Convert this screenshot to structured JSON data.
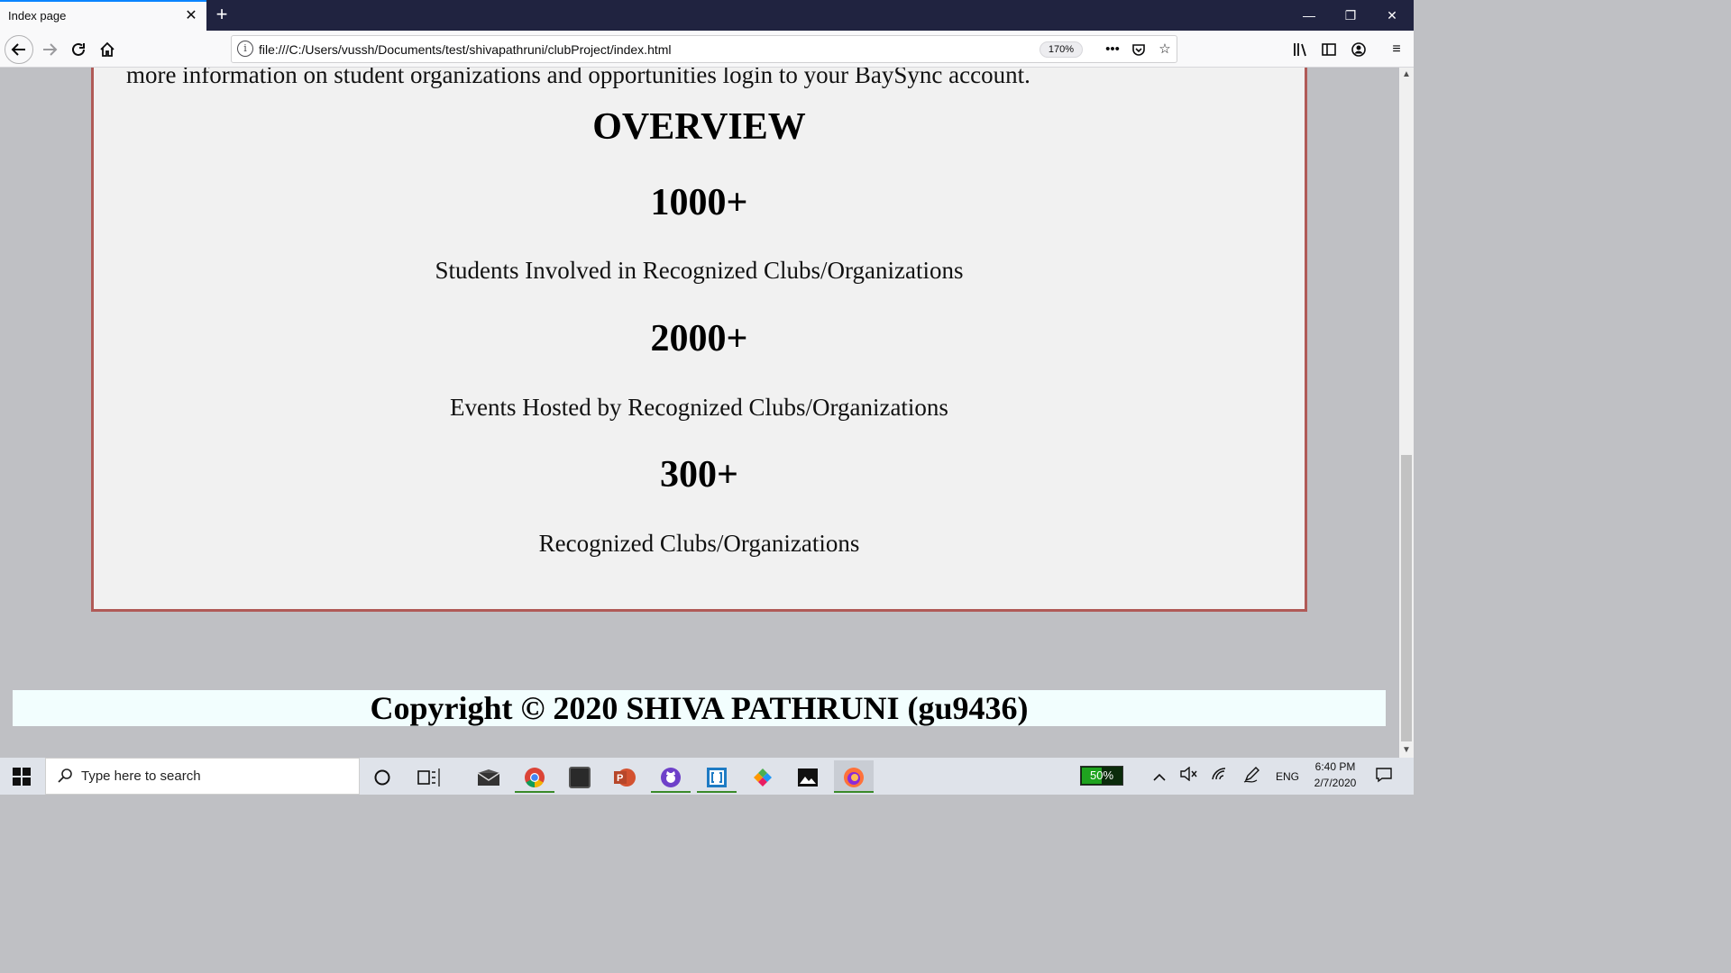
{
  "browser": {
    "tab_title": "Index page",
    "tab_close": "✕",
    "new_tab": "+",
    "url": "file:///C:/Users/vussh/Documents/test/shivapathruni/clubProject/index.html",
    "zoom": "170%",
    "window_controls": [
      "—",
      "❐",
      "✕"
    ],
    "icons": [
      "back-arrow-icon",
      "forward-arrow-icon",
      "reload-icon",
      "home-icon",
      "info-icon",
      "more-icon",
      "pocket-icon",
      "bookmark-star-icon",
      "library-icon",
      "sidebar-icon",
      "account-icon",
      "menu-icon"
    ]
  },
  "page": {
    "intro_text": "more information on student organizations and opportunities login to your BaySync account.",
    "overview_heading": "OVERVIEW",
    "stats": [
      {
        "number": "1000+",
        "label": "Students Involved in Recognized Clubs/Organizations"
      },
      {
        "number": "2000+",
        "label": "Events Hosted by Recognized Clubs/Organizations"
      },
      {
        "number": "300+",
        "label": "Recognized Clubs/Organizations"
      }
    ],
    "footer": "Copyright © 2020 SHIVA PATHRUNI (gu9436)",
    "colors": {
      "card_border": "#b05a57",
      "card_bg": "#f1f1f1",
      "page_bg": "#bfc0c4",
      "footer_bg": "#f2fefe"
    }
  },
  "taskbar": {
    "search_placeholder": "Type here to search",
    "battery": "50%",
    "battery_level": 0.5,
    "language": "ENG",
    "time": "6:40 PM",
    "date": "2/7/2020",
    "apps": [
      "cortana-icon",
      "task-view-icon",
      "mail-icon",
      "chrome-icon",
      "app-icon",
      "powerpoint-icon",
      "github-icon",
      "brackets-icon",
      "paint-icon",
      "photos-icon",
      "firefox-icon"
    ]
  }
}
